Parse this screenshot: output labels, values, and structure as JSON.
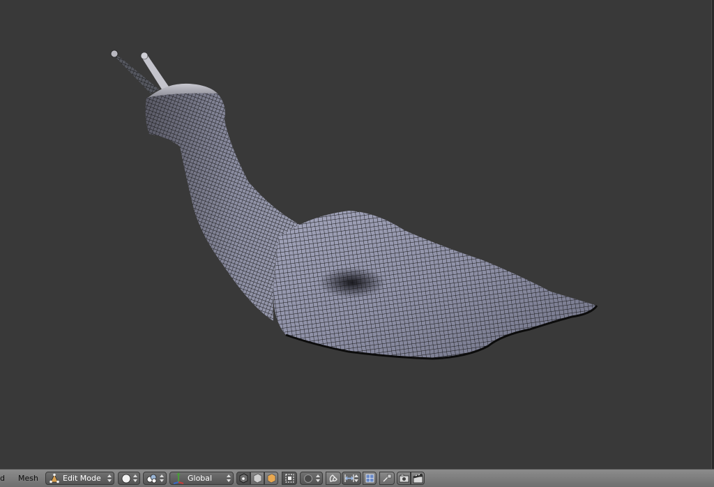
{
  "header": {
    "cut_menu_text": "d",
    "mesh_menu": "Mesh",
    "mode_selector": {
      "label": "Edit Mode",
      "icon": "edit-mode-icon"
    },
    "viewport_shading": {
      "icon": "solid-sphere-icon"
    },
    "pivot_point": {
      "icon": "pivot-point-icon"
    },
    "orientation_selector": {
      "label": "Global",
      "icon": "transform-manipulator-icon"
    },
    "select_modes": [
      "vertex-select-icon",
      "edge-select-icon",
      "face-select-icon"
    ],
    "occlude_geometry_icon": "occlude-geometry-icon",
    "proportional_editing_icon": "proportional-editing-icon",
    "snap_icon": "magnet-icon",
    "snap_element_icon": "snap-element-icon",
    "snap_target_icon": "snap-target-icon",
    "render_icons": [
      "camera-icon",
      "clapper-icon"
    ]
  },
  "colors": {
    "viewport_bg": "#393939",
    "header_bg": "#7a7a7a",
    "mesh_fill": "#9a9cb0",
    "wire": "#111111"
  }
}
